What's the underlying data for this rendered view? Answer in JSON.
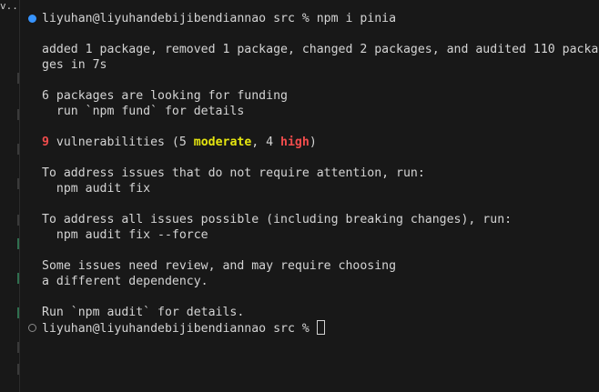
{
  "panel": {
    "tab_label": "v..."
  },
  "terminal": {
    "prompt1": "liyuhan@liyuhandebijibendiannao src % npm i pinia",
    "added_line1": "added 1 package, removed 1 package, changed 2 packages, and audited 110 packa",
    "added_line2": "ges in 7s",
    "funding_line1": "6 packages are looking for funding",
    "funding_line2": "  run `npm fund` for details",
    "vuln_count": "9",
    "vuln_text1": " vulnerabilities (5 ",
    "vuln_moderate": "moderate",
    "vuln_text2": ", 4 ",
    "vuln_high": "high",
    "vuln_text3": ")",
    "fix1_line1": "To address issues that do not require attention, run:",
    "fix1_line2": "  npm audit fix",
    "fix2_line1": "To address all issues possible (including breaking changes), run:",
    "fix2_line2": "  npm audit fix --force",
    "review_line1": "Some issues need review, and may require choosing",
    "review_line2": "a different dependency.",
    "details_line": "Run `npm audit` for details.",
    "prompt2": "liyuhan@liyuhandebijibendiannao src % "
  },
  "colors": {
    "background": "#181818",
    "text": "#d4d4d4",
    "red": "#f14c4c",
    "yellow": "#e5e510",
    "command_dot": "#3794ff"
  }
}
